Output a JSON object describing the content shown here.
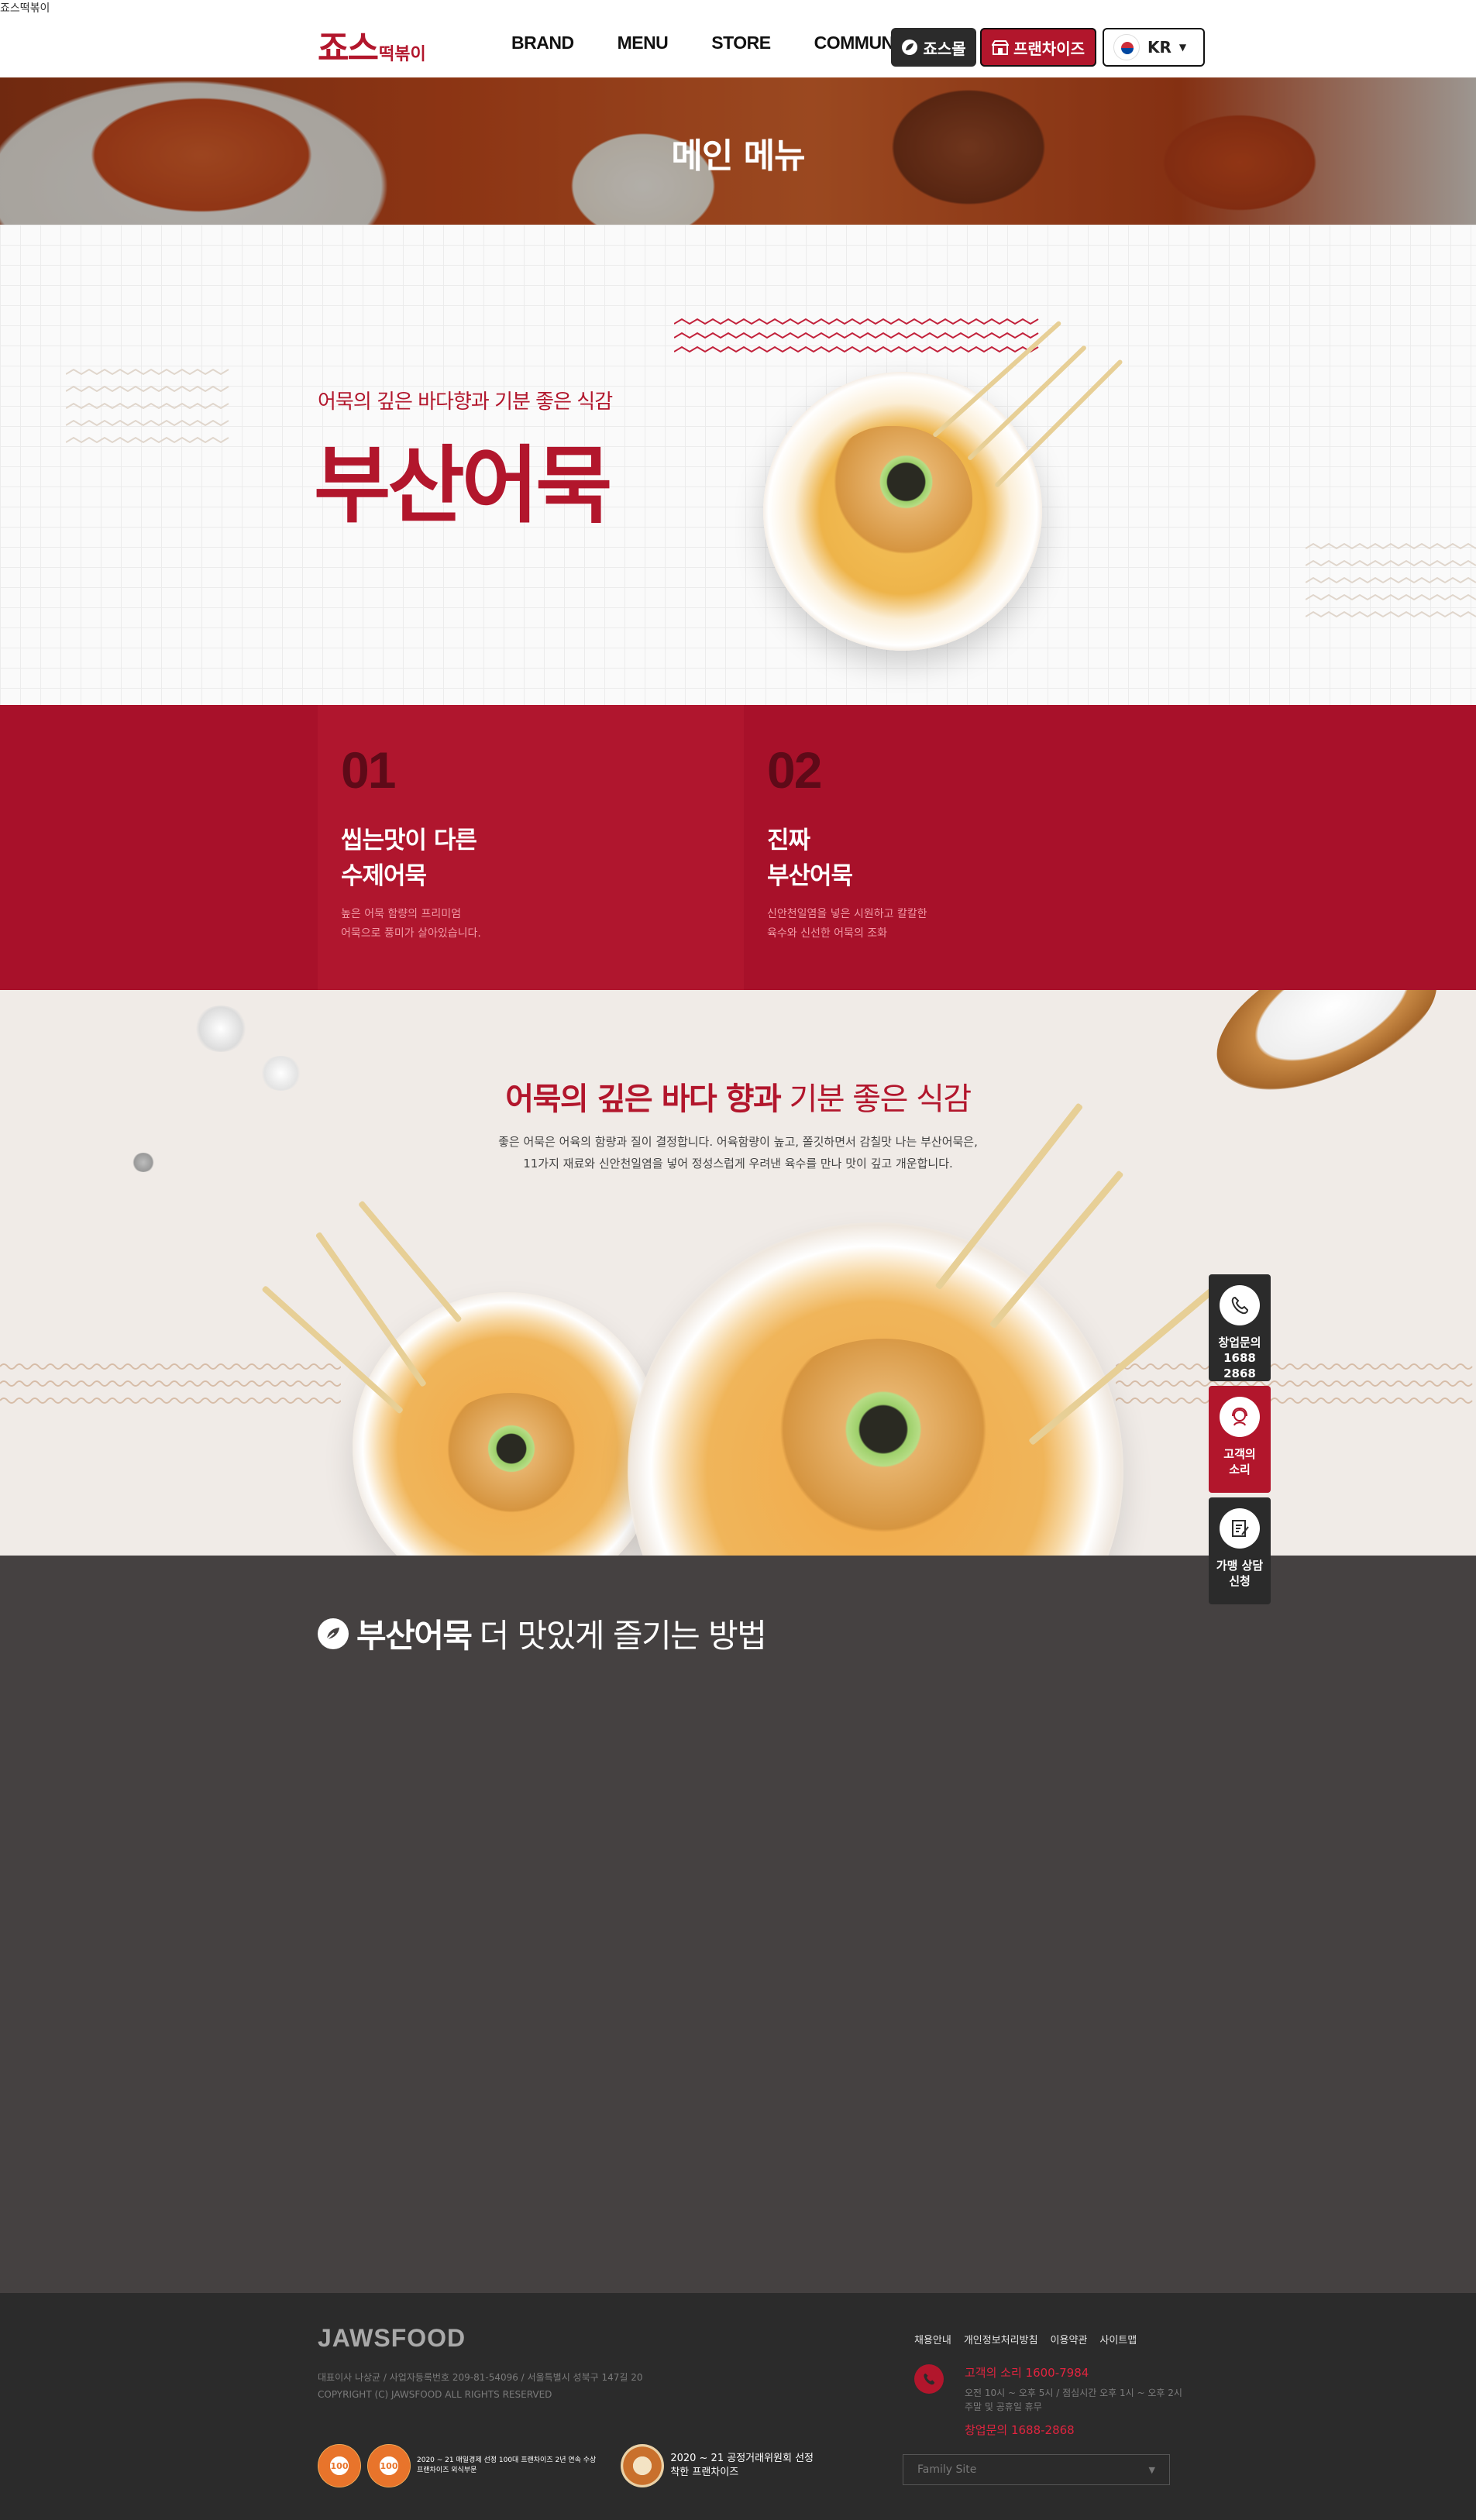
{
  "document_title": "죠스떡볶이",
  "header": {
    "logo_main": "죠스",
    "logo_sub": "떡볶이",
    "nav": [
      "BRAND",
      "MENU",
      "STORE",
      "COMMUNITY"
    ],
    "jaws_button": "죠스몰",
    "franchise_button": "프랜차이즈",
    "language": "KR",
    "colors": {
      "brand_red": "#b2162c",
      "dark": "#2b2b2b"
    }
  },
  "banner": {
    "title": "메인 메뉴"
  },
  "hero": {
    "subtitle": "어묵의 깊은 바다향과 기분 좋은 식감",
    "title": "부산어묵"
  },
  "features": [
    {
      "num": "01",
      "title": "씹는맛이 다른\n수제어묵",
      "desc": "높은 어묵 함량의 프리미엄\n어묵으로 풍미가 살아있습니다."
    },
    {
      "num": "02",
      "title": "진짜\n부산어묵",
      "desc": "신안천일염을 넣은 시원하고 칼칼한\n육수와 신선한 어묵의 조화"
    }
  ],
  "story": {
    "title_bold": "어묵의 깊은 바다 향과",
    "title_light": "기분 좋은 식감",
    "desc": "좋은 어묵은 어육의 함량과 질이 결정합니다. 어육함량이 높고, 쫄깃하면서 감칠맛 나는 부산어묵은,\n11가지 재료와 신안천일염을 넣어 정성스럽게 우려낸 육수를 만나 맛이 깊고 개운합니다."
  },
  "recipe": {
    "title_bold": "부산어묵",
    "title_light": "더 맛있게 즐기는 방법"
  },
  "side_menu": [
    {
      "label": "창업문의\n1688 2868",
      "icon": "phone-icon"
    },
    {
      "label": "고객의\n소리",
      "icon": "headset-icon"
    },
    {
      "label": "가맹 상담\n신청",
      "icon": "form-icon"
    }
  ],
  "footer": {
    "logo": "JAWSFOOD",
    "info": "대표이사 나상균 / 사업자등록번호 209-81-54096 / 서울특별시 성북구 147길 20\nCOPYRIGHT (C) JAWSFOOD ALL RIGHTS RESERVED",
    "links": [
      "채용안내",
      "개인정보처리방침",
      "이용약관",
      "사이트맵"
    ],
    "cs_line": "고객의 소리 1600-7984",
    "hours": "오전 10시 ~ 오후 5시 / 점심시간 오후 1시 ~ 오후 2시\n주말 및 공휴일 휴무",
    "startup_line": "창업문의 1688-2868",
    "family_site": "Family Site",
    "badge1_text": "2020 ~ 21 매일경제 선정 100대 프랜차이즈 2년 연속 수상\n프랜차이즈 외식부문",
    "badge2_text": "2020 ~ 21 공정거래위원회 선정\n착한 프랜차이즈",
    "badge_label": "100"
  }
}
